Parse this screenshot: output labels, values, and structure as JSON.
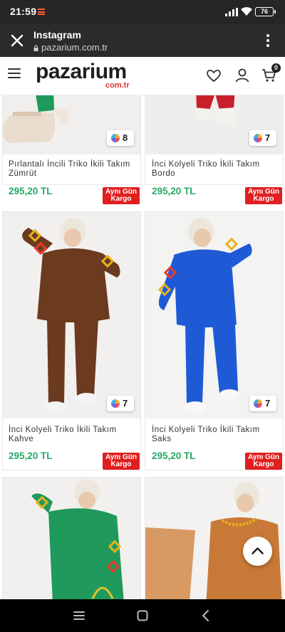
{
  "status_bar": {
    "time": "21:59",
    "battery": "76"
  },
  "browser": {
    "title": "Instagram",
    "url": "pazarium.com.tr"
  },
  "header": {
    "logo": "pazarium",
    "logo_sub": "com.tr",
    "cart_count": "0"
  },
  "products": [
    {
      "name": "Pırlantalı İncili Triko İkili Takım Zümrüt",
      "price": "295,20 TL",
      "colors": "8",
      "badge_line1": "Aynı Gün",
      "badge_line2": "Kargo",
      "color": "#1e9b5a"
    },
    {
      "name": "İnci Kolyeli Triko İkili Takım Bordo",
      "price": "295,20 TL",
      "colors": "7",
      "badge_line1": "Aynı Gün",
      "badge_line2": "Kargo",
      "color": "#c8202b"
    },
    {
      "name": "İnci Kolyeli Triko İkili Takım Kahve",
      "price": "295,20 TL",
      "colors": "7",
      "badge_line1": "Aynı Gün",
      "badge_line2": "Kargo",
      "color": "#6b3a1f"
    },
    {
      "name": "İnci Kolyeli Triko İkili Takım Saks",
      "price": "295,20 TL",
      "colors": "7",
      "badge_line1": "Aynı Gün",
      "badge_line2": "Kargo",
      "color": "#1f5ad6"
    },
    {
      "name": "",
      "price": "",
      "colors": "",
      "badge_line1": "",
      "badge_line2": "",
      "color": "#1f9a5c"
    },
    {
      "name": "",
      "price": "",
      "colors": "",
      "badge_line1": "",
      "badge_line2": "",
      "color": "#c97937"
    }
  ],
  "colors": {
    "price": "#25a866",
    "badge": "#e01f1f",
    "status_bar": "#262626",
    "tab_bar": "#2b2b2b",
    "logo_sub": "#e8302e"
  }
}
